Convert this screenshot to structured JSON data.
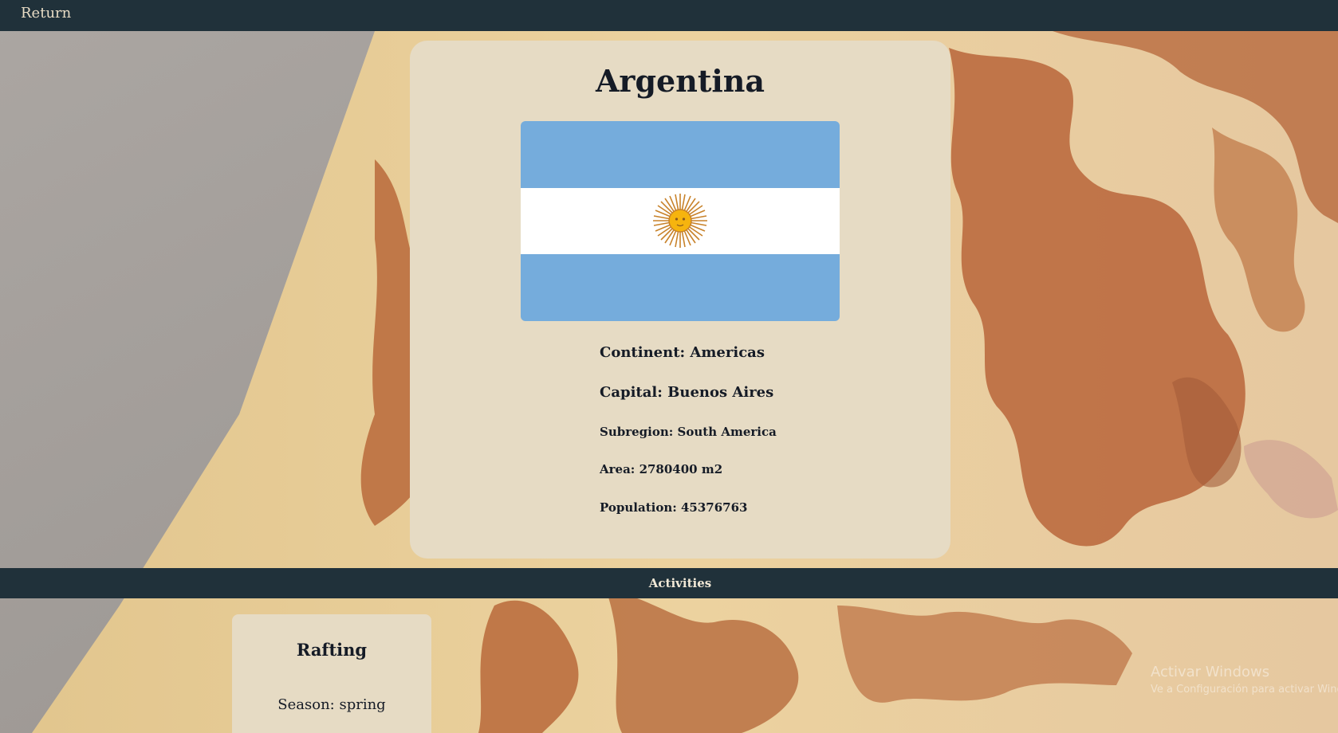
{
  "nav": {
    "return_label": "Return"
  },
  "country": {
    "name": "Argentina",
    "flag_icon": "argentina-flag",
    "continent": "Continent: Americas",
    "capital": "Capital: Buenos Aires",
    "subregion": "Subregion: South America",
    "area": "Area: 2780400 m2",
    "population": "Population: 45376763"
  },
  "activities": {
    "title": "Activities",
    "items": [
      {
        "name": "Rafting",
        "season": "Season: spring"
      }
    ]
  },
  "watermark": {
    "title": "Activar Windows",
    "subtitle": "Ve a Configuración para activar Windows."
  },
  "colors": {
    "nav_bg": "#20313a",
    "card_bg": "#e6dbc4",
    "text_dark": "#151b26",
    "flag_blue": "#75acdc",
    "flag_white": "#ffffff",
    "flag_sun": "#f6b40e"
  }
}
